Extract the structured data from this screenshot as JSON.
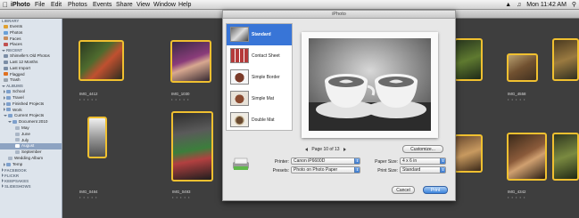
{
  "menubar": {
    "app": "iPhoto",
    "items": [
      "File",
      "Edit",
      "Photos",
      "Events",
      "Share",
      "View",
      "Window",
      "Help"
    ],
    "status_time": "Mon 11:42 AM"
  },
  "window": {
    "title": "iPhoto"
  },
  "sidebar": {
    "library_header": "LIBRARY",
    "library": [
      "Events",
      "Photos",
      "Faces",
      "Places"
    ],
    "recent_header": "RECENT",
    "recent": [
      "Shimelle's Old Photos",
      "Last 12 Months",
      "Last Import",
      "Flagged",
      "Trash"
    ],
    "albums_header": "ALBUMS",
    "albums": [
      "School",
      "Travel",
      "Finished Projects",
      "Work",
      "Current Projects",
      "Document 2010",
      "May",
      "June",
      "July",
      "August",
      "September",
      "Wedding Album",
      "Temp"
    ],
    "bottom": [
      "FACEBOOK",
      "FLICKR",
      "KEEPSAKES",
      "SLIDESHOWS"
    ]
  },
  "thumbnails": {
    "captions": [
      "IMG_4412",
      "IMG_1030",
      "IMG_0484",
      "IMG_0493",
      "IMG_4558",
      "IMG_4342"
    ],
    "rating": "• • • • •"
  },
  "dialog": {
    "title": "iPhoto",
    "themes": [
      "Standard",
      "Contact Sheet",
      "Simple Border",
      "Simple Mat",
      "Double Mat"
    ],
    "selected_theme": "Standard",
    "page_label": "Page 10 of 13",
    "customize_label": "Customize...",
    "printer_label": "Printer:",
    "printer_value": "Canon iP6600D",
    "presets_label": "Presets:",
    "presets_value": "Photo on Photo Paper",
    "paper_size_label": "Paper Size:",
    "paper_size_value": "4 x 6 in",
    "print_size_label": "Print Size:",
    "print_size_value": "Standard",
    "cancel_label": "Cancel",
    "print_label": "Print"
  },
  "colors": {
    "selection": "#3875d7",
    "thumb_border": "#f0c030",
    "default_button": "#3a83dc"
  }
}
